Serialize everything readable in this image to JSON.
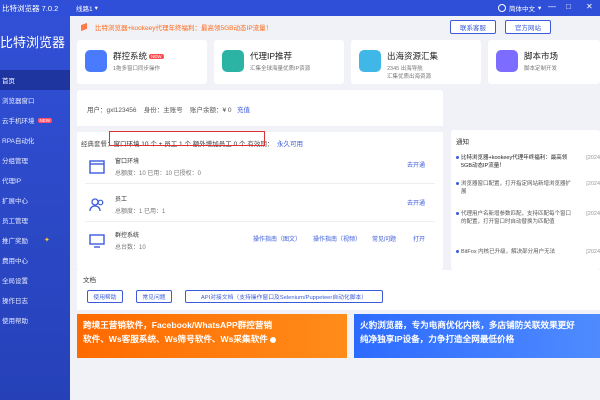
{
  "topbar": {
    "app_title": "比特浏览器 7.0.2",
    "line_label": "线路1",
    "language": "简体中文",
    "minimize": "—",
    "maximize": "□",
    "close": "✕"
  },
  "sidebar": {
    "brand": "比特浏览器",
    "items": [
      {
        "label": "首页"
      },
      {
        "label": "浏览器窗口"
      },
      {
        "label": "云手机环境",
        "badge": "NEW"
      },
      {
        "label": "RPA自动化"
      },
      {
        "label": "分组管理"
      },
      {
        "label": "代理IP"
      },
      {
        "label": "扩展中心"
      },
      {
        "label": "员工管理"
      },
      {
        "label": "推广奖励"
      },
      {
        "label": "费用中心"
      },
      {
        "label": "全局设置"
      },
      {
        "label": "操作日志"
      },
      {
        "label": "使用帮助"
      }
    ]
  },
  "notice": {
    "text": "比特浏览器+kookeey代理年终福利：最高领5GB动态IP流量！",
    "contact_support": "联系客服",
    "official_site": "官方网站"
  },
  "cards": [
    {
      "title": "群控系统",
      "badge": "NEW",
      "desc": "1拖多窗口同步操作",
      "desc2": "",
      "color": "#4a7bff"
    },
    {
      "title": "代理IP推荐",
      "badge": "",
      "desc": "汇集全球海量优质IP资源",
      "desc2": "",
      "color": "#2bb4a3"
    },
    {
      "title": "出海资源汇集",
      "badge": "",
      "desc": "2345 出海导航",
      "desc2": "汇集优质出海资源",
      "color": "#3fb8e8"
    },
    {
      "title": "脚本市场",
      "badge": "",
      "desc": "脚本定制开发",
      "desc2": "",
      "color": "#7c6cff"
    }
  ],
  "account": {
    "user_label": "用户：",
    "user": "gxl123456",
    "role_label": "身份：",
    "role": "主账号",
    "balance_label": "账户余额：",
    "balance": "¥ 0",
    "recharge": "充值",
    "plan_prefix": "经典套餐：",
    "plan_detail": "窗口环境 10 个 + 员工 1 个 额外增加员工 0 个",
    "validity_label": "有效期：",
    "validity": "永久可用"
  },
  "rows": [
    {
      "title": "窗口环境",
      "sub": "总额度：10   已用：10   已授权：0",
      "actions": [
        "去开通"
      ]
    },
    {
      "title": "员工",
      "sub": "总额度：1   已用：1",
      "actions": [
        "去开通"
      ]
    },
    {
      "title": "群控系统",
      "sub": "总台数：10",
      "actions": [
        "操作指南（图文）",
        "操作指南（视频）",
        "常见问题",
        "打开"
      ]
    }
  ],
  "notice_panel": {
    "title": "通知",
    "items": [
      {
        "text": "比特浏览器+kookeey代理年终福利：最高领5GB动态IP流量！",
        "date": "[2024"
      },
      {
        "text": "浏览器窗口配置，打开指定网站新增浏览器扩展",
        "date": "[2024"
      },
      {
        "text": "代理用户名新增参数匹配，支持匹配每个窗口的配置，打开窗口时自动替换为匹配值",
        "date": "[2024"
      },
      {
        "text": "BitFox 内核已升级，解决部分用户无法",
        "date": "[2024"
      }
    ]
  },
  "docs": {
    "title": "文档",
    "buttons": [
      "使用帮助",
      "常见问题",
      "API对接文档（支持操作窗口及Selenium/Puppeteer自动化脚本）"
    ]
  },
  "banners": {
    "orange_line1": "跨境王营销软件，Facebook/WhatsAPP群控营销",
    "orange_line2": "软件、Ws客服系统、Ws筛号软件、Ws采集软件",
    "blue_line1": "火豹浏览器，专为电商优化内核，多店铺防关联效果更好",
    "blue_line2": "纯净独享IP设备，力争打造全网最低价格"
  }
}
